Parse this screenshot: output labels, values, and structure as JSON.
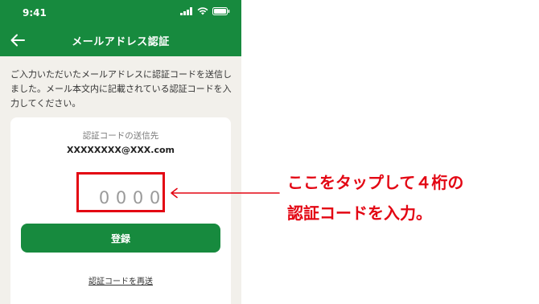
{
  "status_bar": {
    "time": "9:41"
  },
  "header": {
    "title": "メールアドレス認証"
  },
  "instruction": "ご入力いただいたメールアドレスに認証コードを送信しました。メール本文内に記載されている認証コードを入力してください。",
  "card": {
    "destination_label": "認証コードの送信先",
    "destination_email": "XXXXXXXX@XXX.com",
    "code_digits": [
      "0",
      "0",
      "0",
      "0"
    ],
    "register_label": "登録",
    "resend_label": "認証コードを再送"
  },
  "annotation": {
    "line1": "ここをタップして４桁の",
    "line2": "認証コードを入力。"
  },
  "colors": {
    "brand_green": "#178a3e",
    "highlight_red": "#e30613",
    "background": "#f2f0eb"
  },
  "icons": [
    "signal-icon",
    "wifi-icon",
    "battery-icon",
    "back-arrow-icon"
  ]
}
